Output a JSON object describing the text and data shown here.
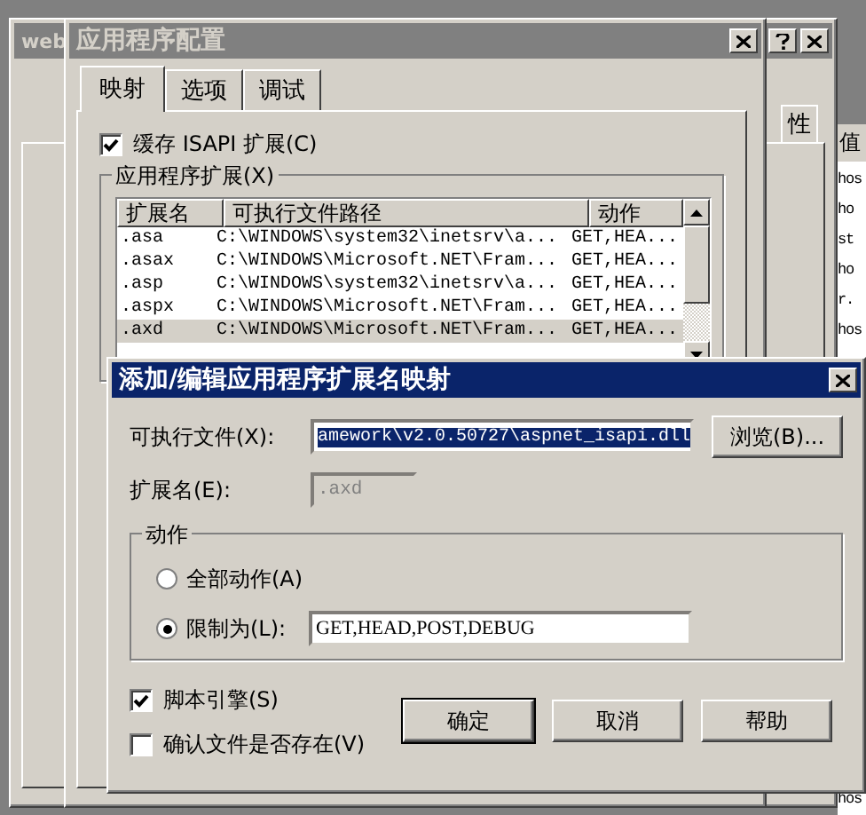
{
  "background_list": {
    "header": "值",
    "items": [
      "hos",
      "ho",
      "st",
      "ho",
      "r.",
      "hos"
    ],
    "bottom_item": "hos"
  },
  "back_window": {
    "title": "web",
    "tabs": [
      {
        "label": "性",
        "selected": false
      }
    ]
  },
  "config_window": {
    "title": "应用程序配置",
    "tabs": [
      {
        "label": "映射",
        "selected": true
      },
      {
        "label": "选项",
        "selected": false
      },
      {
        "label": "调试",
        "selected": false
      }
    ],
    "cache_isapi": {
      "label": "缓存 ISAPI 扩展(C)",
      "checked": true
    },
    "group_title": "应用程序扩展(X)",
    "columns": [
      "扩展名",
      "可执行文件路径",
      "动作"
    ],
    "rows": [
      {
        "cells": [
          ".asa",
          "C:\\WINDOWS\\system32\\inetsrv\\a...",
          "GET,HEA..."
        ],
        "selected": false
      },
      {
        "cells": [
          ".asax",
          "C:\\WINDOWS\\Microsoft.NET\\Fram...",
          "GET,HEA..."
        ],
        "selected": false
      },
      {
        "cells": [
          ".asp",
          "C:\\WINDOWS\\system32\\inetsrv\\a...",
          "GET,HEA..."
        ],
        "selected": false
      },
      {
        "cells": [
          ".aspx",
          "C:\\WINDOWS\\Microsoft.NET\\Fram...",
          "GET,HEA..."
        ],
        "selected": false
      },
      {
        "cells": [
          ".axd",
          "C:\\WINDOWS\\Microsoft.NET\\Fram...",
          "GET,HEA..."
        ],
        "selected": true
      }
    ]
  },
  "dialog": {
    "title": "添加/编辑应用程序扩展名映射",
    "executable_label": "可执行文件(X):",
    "executable_value": "amework\\v2.0.50727\\aspnet_isapi.dll",
    "browse_button": "浏览(B)...",
    "extension_label": "扩展名(E):",
    "extension_value": ".axd",
    "actions_group": "动作",
    "actions": [
      {
        "label": "全部动作(A)",
        "selected": false
      },
      {
        "label": "限制为(L):",
        "selected": true,
        "value": "GET,HEAD,POST,DEBUG"
      }
    ],
    "checkboxes": [
      {
        "label": "脚本引擎(S)",
        "checked": true
      },
      {
        "label": "确认文件是否存在(V)",
        "checked": false
      }
    ],
    "buttons": [
      {
        "label": "确定",
        "default": true
      },
      {
        "label": "取消",
        "default": false
      },
      {
        "label": "帮助",
        "default": false
      }
    ]
  }
}
